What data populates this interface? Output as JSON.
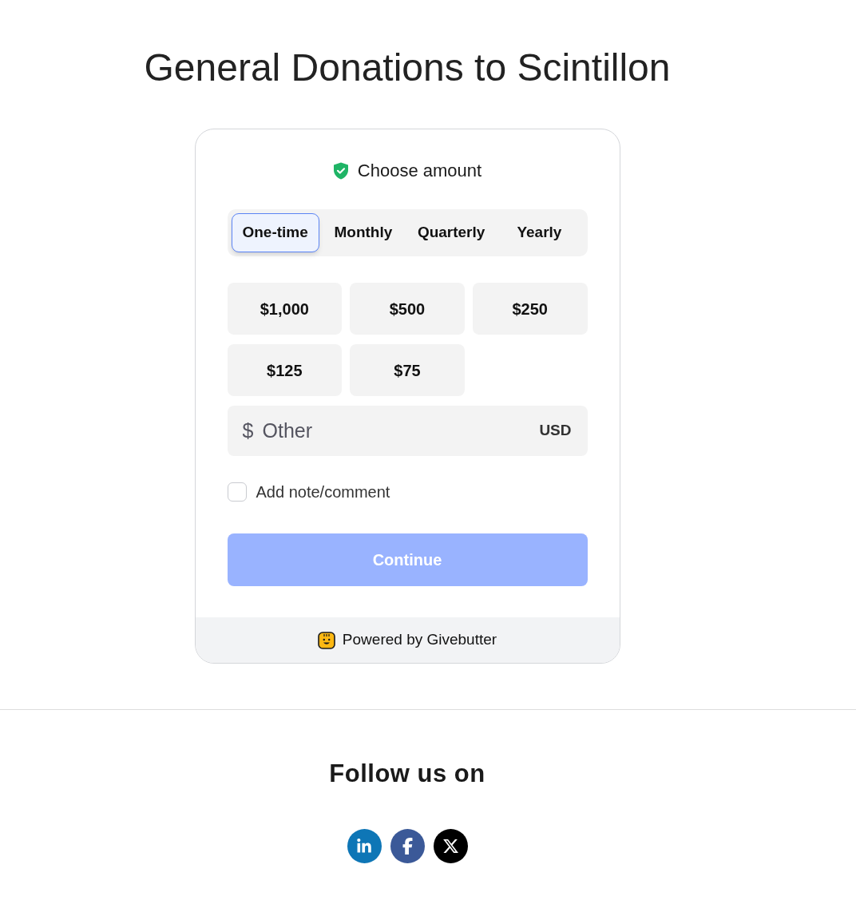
{
  "page": {
    "title": "General Donations to Scintillon"
  },
  "donation_form": {
    "heading": "Choose amount",
    "frequency_tabs": [
      {
        "label": "One-time",
        "selected": true
      },
      {
        "label": "Monthly",
        "selected": false
      },
      {
        "label": "Quarterly",
        "selected": false
      },
      {
        "label": "Yearly",
        "selected": false
      }
    ],
    "amounts": [
      {
        "label": "$1,000",
        "selected": false
      },
      {
        "label": "$500",
        "selected": false
      },
      {
        "label": "$250",
        "selected": false
      },
      {
        "label": "$125",
        "selected": false
      },
      {
        "label": "$75",
        "selected": false
      }
    ],
    "other_amount": {
      "prefix": "$",
      "placeholder": "Other",
      "currency": "USD"
    },
    "note_checkbox": {
      "label": "Add note/comment",
      "checked": false
    },
    "continue_button": {
      "label": "Continue",
      "disabled": true
    },
    "footer": {
      "text": "Powered by Givebutter"
    }
  },
  "social": {
    "heading": "Follow us on",
    "links": [
      {
        "kind": "linkedin"
      },
      {
        "kind": "facebook"
      },
      {
        "kind": "x"
      }
    ]
  }
}
